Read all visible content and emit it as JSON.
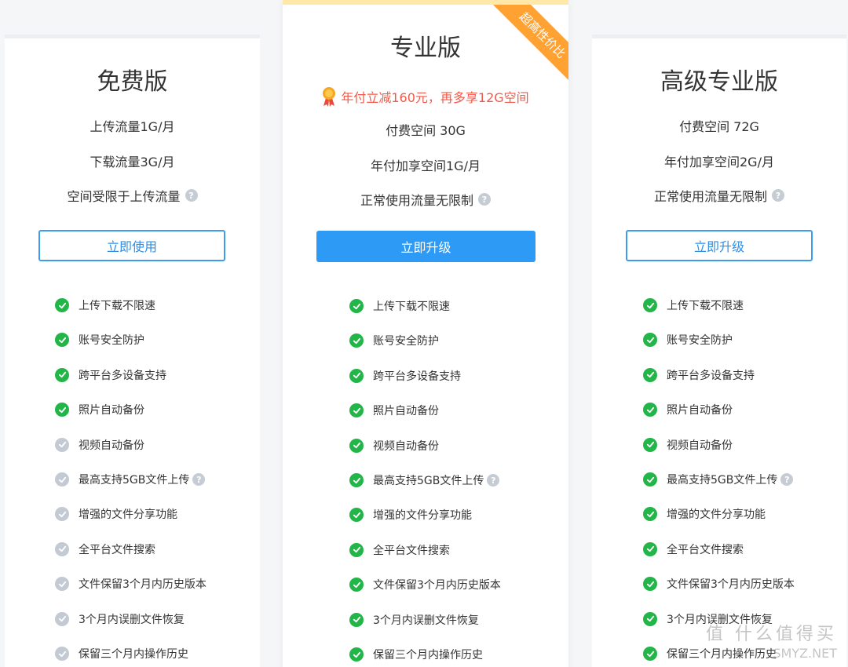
{
  "plans": [
    {
      "title": "免费版",
      "promo": "",
      "specs": [
        "上传流量1G/月",
        "下载流量3G/月",
        "空间受限于上传流量"
      ],
      "button": "立即使用",
      "features": [
        {
          "label": "上传下载不限速",
          "included": true
        },
        {
          "label": "账号安全防护",
          "included": true
        },
        {
          "label": "跨平台多设备支持",
          "included": true
        },
        {
          "label": "照片自动备份",
          "included": true
        },
        {
          "label": "视频自动备份",
          "included": false
        },
        {
          "label": "最高支持5GB文件上传",
          "included": false
        },
        {
          "label": "增强的文件分享功能",
          "included": false
        },
        {
          "label": "全平台文件搜索",
          "included": false
        },
        {
          "label": "文件保留3个月内历史版本",
          "included": false
        },
        {
          "label": "3个月内误删文件恢复",
          "included": false
        },
        {
          "label": "保留三个月内操作历史",
          "included": false
        }
      ]
    },
    {
      "title": "专业版",
      "ribbon": "超高性价比",
      "promo": "年付立减160元，再多享12G空间",
      "specs": [
        "付费空间 30G",
        "年付加享空间1G/月",
        "正常使用流量无限制"
      ],
      "button": "立即升级",
      "features": [
        {
          "label": "上传下载不限速",
          "included": true
        },
        {
          "label": "账号安全防护",
          "included": true
        },
        {
          "label": "跨平台多设备支持",
          "included": true
        },
        {
          "label": "照片自动备份",
          "included": true
        },
        {
          "label": "视频自动备份",
          "included": true
        },
        {
          "label": "最高支持5GB文件上传",
          "included": true
        },
        {
          "label": "增强的文件分享功能",
          "included": true
        },
        {
          "label": "全平台文件搜索",
          "included": true
        },
        {
          "label": "文件保留3个月内历史版本",
          "included": true
        },
        {
          "label": "3个月内误删文件恢复",
          "included": true
        },
        {
          "label": "保留三个月内操作历史",
          "included": true
        }
      ]
    },
    {
      "title": "高级专业版",
      "promo": "",
      "specs": [
        "付费空间 72G",
        "年付加享空间2G/月",
        "正常使用流量无限制"
      ],
      "button": "立即升级",
      "features": [
        {
          "label": "上传下载不限速",
          "included": true
        },
        {
          "label": "账号安全防护",
          "included": true
        },
        {
          "label": "跨平台多设备支持",
          "included": true
        },
        {
          "label": "照片自动备份",
          "included": true
        },
        {
          "label": "视频自动备份",
          "included": true
        },
        {
          "label": "最高支持5GB文件上传",
          "included": true
        },
        {
          "label": "增强的文件分享功能",
          "included": true
        },
        {
          "label": "全平台文件搜索",
          "included": true
        },
        {
          "label": "文件保留3个月内历史版本",
          "included": true
        },
        {
          "label": "3个月内误删文件恢复",
          "included": true
        },
        {
          "label": "保留三个月内操作历史",
          "included": true
        }
      ]
    }
  ],
  "watermark": {
    "line1": "值 什么值得买",
    "line2": "SMYZ.NET"
  },
  "colors": {
    "accent": "#2d9bf5",
    "check_on": "#22b548",
    "check_off": "#c4cad3",
    "promo": "#f05a4a",
    "ribbon": "#ffa232"
  }
}
